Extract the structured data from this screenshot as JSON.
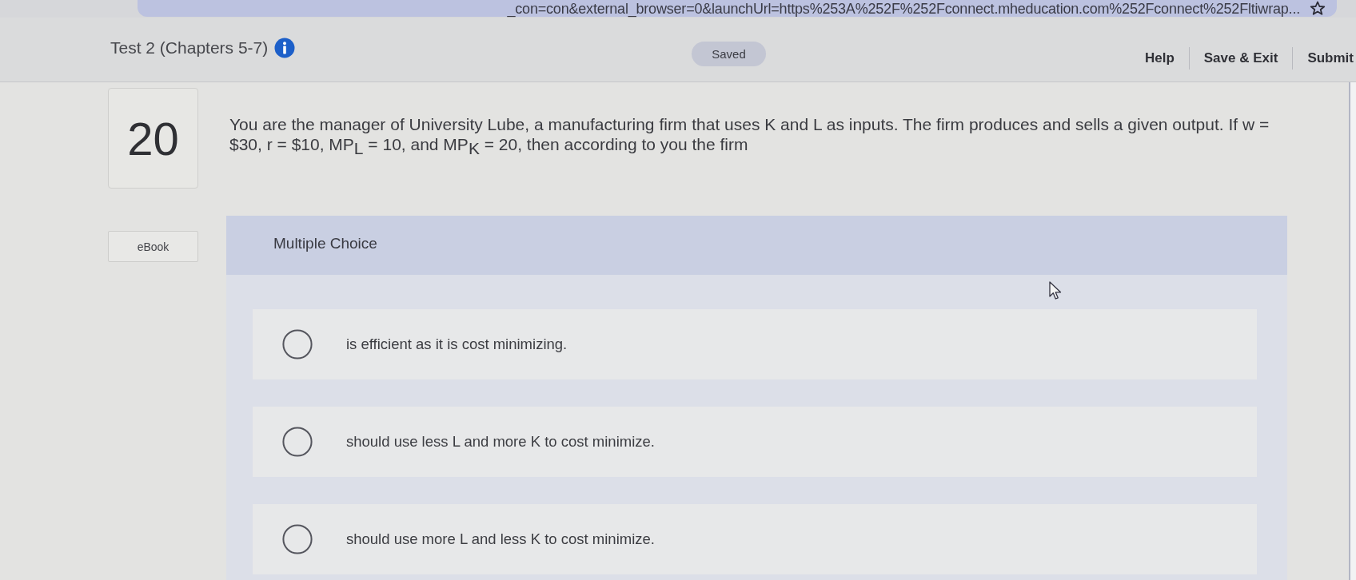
{
  "browser": {
    "url": "_con=con&external_browser=0&launchUrl=https%253A%252F%252Fconnect.mheducation.com%252Fconnect%252Fltiwrap..."
  },
  "header": {
    "title": "Test 2 (Chapters 5-7)",
    "status": "Saved",
    "links": [
      "Help",
      "Save & Exit",
      "Submit"
    ]
  },
  "question": {
    "number": "20",
    "text": "You are the manager of University Lube, a manufacturing firm that uses K and L as inputs. The firm produces and sells a given output. If w = $30, r = $10, MP$_{L}$ = 10, and MP$_{K}$ = 20, then according to you the firm"
  },
  "ebook_button": {
    "label": "eBook"
  },
  "answer_panel": {
    "heading": "Multiple Choice",
    "choices": [
      {
        "text": "is efficient as it is cost minimizing.",
        "selected": false
      },
      {
        "text": "should use less L and more K to cost minimize.",
        "selected": false
      },
      {
        "text": "should use more L and less K to cost minimize.",
        "selected": false
      }
    ]
  }
}
